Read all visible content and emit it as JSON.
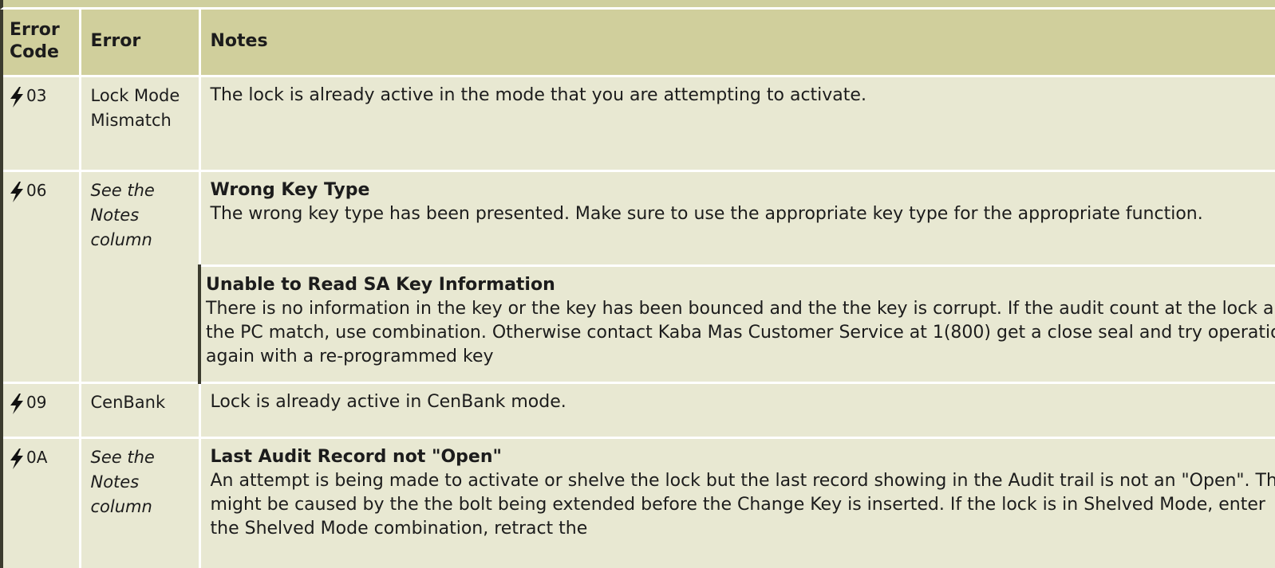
{
  "table": {
    "headers": {
      "code": "Error Code",
      "error": "Error",
      "notes": "Notes"
    },
    "rows": [
      {
        "code": "03",
        "error": "Lock Mode Mismatch",
        "notes": [
          {
            "title": "",
            "body": "The lock is already active in the mode that you are attempting to activate."
          }
        ]
      },
      {
        "code": "06",
        "error": "See the Notes column",
        "notes": [
          {
            "title": "Wrong Key Type",
            "body": "The wrong key type has been presented. Make sure to use the appropriate key type for the appropriate function."
          },
          {
            "title": "Unable to Read SA Key Information",
            "body": "There is no information in the key or the key has been bounced and the the key is corrupt. If the audit count at the lock and the PC match, use combination. Otherwise contact Kaba Mas Customer Service at 1(800) get a close seal and try operation again with a re-programmed key"
          }
        ]
      },
      {
        "code": "09",
        "error": "CenBank",
        "notes": [
          {
            "title": "",
            "body": "Lock is already active in CenBank mode."
          }
        ]
      },
      {
        "code": "0A",
        "error": "See the Notes column",
        "notes": [
          {
            "title": "Last Audit Record not \"Open\"",
            "body": "An attempt is being made to activate or shelve the lock but the last record showing in the Audit trail is not an \"Open\". This might be caused by the the bolt being extended before the Change Key is inserted. If the lock is in Shelved Mode, enter the Shelved Mode combination, retract the"
          }
        ]
      }
    ]
  }
}
